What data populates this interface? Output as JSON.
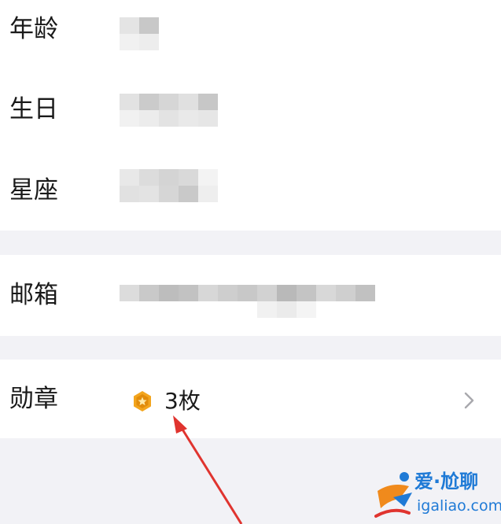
{
  "profile": {
    "age_label": "年龄",
    "birthday_label": "生日",
    "zodiac_label": "星座",
    "email_label": "邮箱",
    "medal_label": "勋章",
    "medal_count": "3枚"
  },
  "icons": {
    "medal": "medal-star-icon",
    "chevron": "chevron-right-icon"
  },
  "watermark": {
    "title": "爱·尬聊",
    "url": "igaliao.com"
  },
  "colors": {
    "background": "#f2f2f6",
    "card": "#ffffff",
    "arrow": "#e0342f",
    "medal": "#f3a51d",
    "watermark": "#1f7ad6"
  }
}
